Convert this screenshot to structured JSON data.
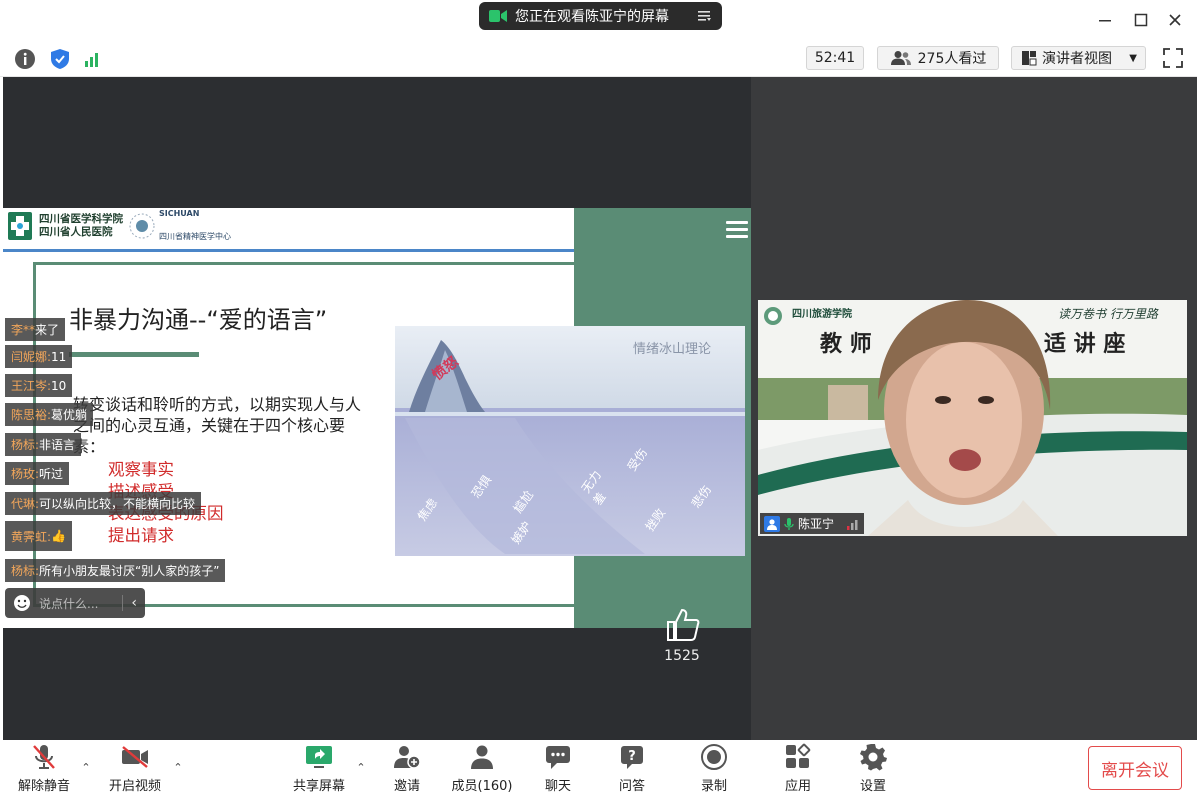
{
  "window": {
    "share_banner": "您正在观看陈亚宁的屏幕"
  },
  "status_bar": {
    "timer": "52:41",
    "viewers": "275人看过",
    "view_mode": "演讲者视图"
  },
  "slide": {
    "logo_line1": "四川省医学科学院",
    "logo_line2": "四川省人民医院",
    "logo_en": "SICHUAN",
    "logo_center": "四川省精神医学中心",
    "heading": "非暴力沟通--“爱的语言”",
    "body": "转变谈话和聆听的方式，以期实现人与人之间的心灵互通，关键在于四个核心要素：",
    "elements": [
      "观察事实",
      "描述感受",
      "表达感受的原因",
      "提出请求"
    ],
    "image_title": "情绪冰山理论",
    "image_tip_word": "愤怒",
    "image_words": [
      "焦虑",
      "恐惧",
      "尴尬",
      "无力",
      "受伤",
      "挫败",
      "悲伤",
      "嫉妒",
      "羞"
    ]
  },
  "chat": {
    "messages": [
      {
        "name": "李**",
        "text": " 来了"
      },
      {
        "name": "闫妮娜:",
        "text": " 11"
      },
      {
        "name": "王江岑:",
        "text": " 10"
      },
      {
        "name": "陈思裕:",
        "text": " 葛优躺"
      },
      {
        "name": "杨标:",
        "text": " 非语言"
      },
      {
        "name": "杨玫:",
        "text": " 听过"
      },
      {
        "name": "代琳:",
        "text": " 可以纵向比较，不能横向比较"
      },
      {
        "name": "黄霁虹:",
        "text": " 👍"
      },
      {
        "name": "杨标:",
        "text": " 所有小朋友最讨厌“别人家的孩子”"
      }
    ],
    "input_placeholder": "说点什么..."
  },
  "likes": {
    "count": "1525"
  },
  "presenter": {
    "name": "陈亚宁",
    "banner_school": "四川旅游学院",
    "banner_motto": "读万卷书 行万里路",
    "banner_left": "教 师",
    "banner_right": "适 讲 座"
  },
  "toolbar": {
    "unmute": "解除静音",
    "start_video": "开启视频",
    "share_screen": "共享屏幕",
    "invite": "邀请",
    "members": "成员(160)",
    "chat": "聊天",
    "qa": "问答",
    "record": "录制",
    "apps": "应用",
    "settings": "设置",
    "leave": "离开会议"
  },
  "colors": {
    "slide_green": "#5a8c75",
    "leave_red": "#e34b4b",
    "chat_name": "#f2a65a",
    "slide_red": "#d12b2b"
  }
}
